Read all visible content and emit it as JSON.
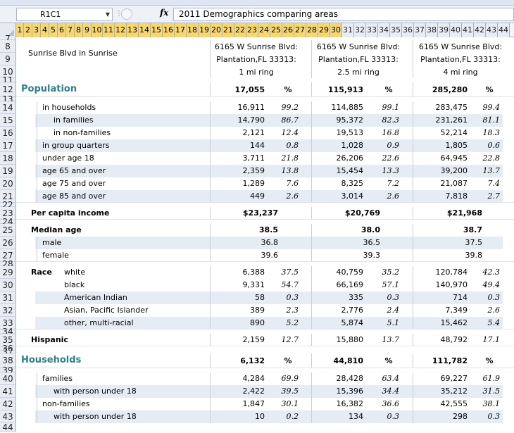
{
  "formula": {
    "namebox": "R1C1",
    "fx": "fx",
    "content": "2011 Demographics  comparing areas"
  },
  "columns": [
    "1",
    "2",
    "3",
    "4",
    "5",
    "6",
    "7",
    "8",
    "9",
    "10",
    "11",
    "12",
    "13",
    "14",
    "15",
    "16",
    "17",
    "18",
    "19",
    "20",
    "21",
    "22",
    "23",
    "24",
    "25",
    "26",
    "27",
    "28",
    "29",
    "30",
    "31",
    "32",
    "33",
    "34",
    "35",
    "36",
    "37",
    "38",
    "39",
    "40",
    "41",
    "42",
    "43",
    "44"
  ],
  "header": {
    "location_label": "Sunrise Blvd in Sunrise",
    "areas": [
      {
        "line1": "6165 W Sunrise Blvd:",
        "line2": "Plantation,FL 33313:",
        "line3": "1 mi ring"
      },
      {
        "line1": "6165 W Sunrise Blvd:",
        "line2": "Plantation,FL 33313:",
        "line3": "2.5 mi ring"
      },
      {
        "line1": "6165 W Sunrise Blvd:",
        "line2": "Plantation,FL 33313:",
        "line3": "4 mi ring"
      }
    ]
  },
  "rows": [
    {
      "n": "12",
      "label": "Population",
      "kind": "section",
      "vals": [
        "17,055",
        "%",
        "115,913",
        "%",
        "285,280",
        "%"
      ]
    },
    {
      "n": "14",
      "label": "in households",
      "indent": 1,
      "vals": [
        "16,911",
        "99.2",
        "114,885",
        "99.1",
        "283,475",
        "99.4"
      ]
    },
    {
      "n": "15",
      "label": "in families",
      "indent": 2,
      "vals": [
        "14,790",
        "86.7",
        "95,372",
        "82.3",
        "231,261",
        "81.1"
      ]
    },
    {
      "n": "16",
      "label": "in non-families",
      "indent": 2,
      "vals": [
        "2,121",
        "12.4",
        "19,513",
        "16.8",
        "52,214",
        "18.3"
      ]
    },
    {
      "n": "17",
      "label": "in group quarters",
      "indent": 1,
      "vals": [
        "144",
        "0.8",
        "1,028",
        "0.9",
        "1,805",
        "0.6"
      ]
    },
    {
      "n": "18",
      "label": "under age 18",
      "indent": 1,
      "vals": [
        "3,711",
        "21.8",
        "26,206",
        "22.6",
        "64,945",
        "22.8"
      ]
    },
    {
      "n": "19",
      "label": "age 65 and over",
      "indent": 1,
      "vals": [
        "2,359",
        "13.8",
        "15,454",
        "13.3",
        "39,200",
        "13.7"
      ]
    },
    {
      "n": "20",
      "label": "age 75 and over",
      "indent": 1,
      "vals": [
        "1,289",
        "7.6",
        "8,325",
        "7.2",
        "21,087",
        "7.4"
      ]
    },
    {
      "n": "21",
      "label": "age 85 and over",
      "indent": 1,
      "vals": [
        "449",
        "2.6",
        "3,014",
        "2.6",
        "7,818",
        "2.7"
      ]
    },
    {
      "n": "23",
      "label": "Per capita income",
      "kind": "bold",
      "vals": [
        "$23,237",
        "",
        "$20,769",
        "",
        "$21,968",
        ""
      ]
    },
    {
      "n": "25",
      "label": "Median age",
      "kind": "bold",
      "vals": [
        "38.5",
        "",
        "38.0",
        "",
        "38.7",
        ""
      ]
    },
    {
      "n": "26",
      "label": "male",
      "indent": 1,
      "vals": [
        "36.8",
        "",
        "36.5",
        "",
        "37.5",
        ""
      ]
    },
    {
      "n": "27",
      "label": "female",
      "indent": 1,
      "vals": [
        "39.6",
        "",
        "39.3",
        "",
        "39.8",
        ""
      ]
    },
    {
      "n": "29",
      "label": "Race",
      "sub": "white",
      "kind": "race",
      "vals": [
        "6,388",
        "37.5",
        "40,759",
        "35.2",
        "120,784",
        "42.3"
      ]
    },
    {
      "n": "30",
      "label": "",
      "sub": "black",
      "kind": "race",
      "vals": [
        "9,331",
        "54.7",
        "66,169",
        "57.1",
        "140,970",
        "49.4"
      ]
    },
    {
      "n": "31",
      "label": "",
      "sub": "American Indian",
      "kind": "race",
      "vals": [
        "58",
        "0.3",
        "335",
        "0.3",
        "714",
        "0.3"
      ]
    },
    {
      "n": "32",
      "label": "",
      "sub": "Asian, Pacific Islander",
      "kind": "race",
      "vals": [
        "389",
        "2.3",
        "2,776",
        "2.4",
        "7,349",
        "2.6"
      ]
    },
    {
      "n": "33",
      "label": "",
      "sub": "other, multi-racial",
      "kind": "race",
      "vals": [
        "890",
        "5.2",
        "5,874",
        "5.1",
        "15,462",
        "5.4"
      ]
    },
    {
      "n": "35",
      "label": "Hispanic",
      "kind": "bold",
      "vals": [
        "2,159",
        "12.7",
        "15,880",
        "13.7",
        "48,792",
        "17.1"
      ]
    },
    {
      "n": "38",
      "label": "Households",
      "kind": "section",
      "vals": [
        "6,132",
        "%",
        "44,810",
        "%",
        "111,782",
        "%"
      ]
    },
    {
      "n": "40",
      "label": "families",
      "indent": 1,
      "vals": [
        "4,284",
        "69.9",
        "28,428",
        "63.4",
        "69,227",
        "61.9"
      ]
    },
    {
      "n": "41",
      "label": "with person under 18",
      "indent": 2,
      "vals": [
        "2,422",
        "39.5",
        "15,396",
        "34.4",
        "35,212",
        "31.5"
      ]
    },
    {
      "n": "42",
      "label": "non-families",
      "indent": 1,
      "vals": [
        "1,847",
        "30.1",
        "16,382",
        "36.6",
        "42,555",
        "38.1"
      ]
    },
    {
      "n": "43",
      "label": "with person under 18",
      "indent": 2,
      "vals": [
        "10",
        "0.2",
        "134",
        "0.3",
        "298",
        "0.3"
      ]
    }
  ],
  "fillers": [
    {
      "n": "7",
      "h": 4
    },
    {
      "n": "11",
      "h": 6
    },
    {
      "n": "13",
      "h": 6
    },
    {
      "n": "22",
      "h": 6
    },
    {
      "n": "24",
      "h": 6
    },
    {
      "n": "28",
      "h": 6
    },
    {
      "n": "34",
      "h": 6
    },
    {
      "n": "36",
      "h": 4
    },
    {
      "n": "37",
      "h": 4
    },
    {
      "n": "39",
      "h": 6
    }
  ]
}
